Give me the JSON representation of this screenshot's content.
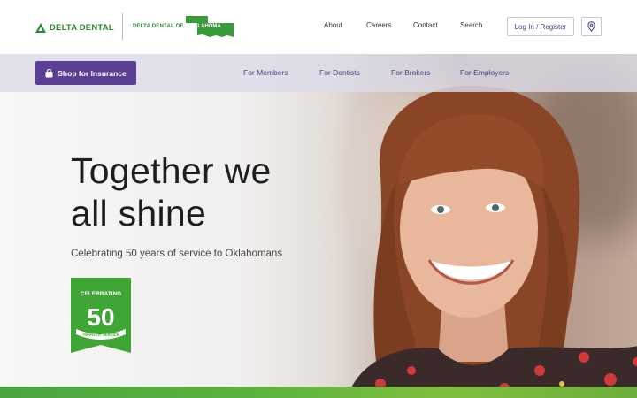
{
  "header": {
    "logo_text": "DELTA DENTAL",
    "sub_logo_prefix": "DELTA DENTAL OF",
    "sub_logo_state": "OKLAHOMA",
    "nav": [
      "About",
      "Careers",
      "Contact",
      "Search"
    ],
    "login_label": "Log In / Register",
    "location_icon": "location-pin-icon"
  },
  "subnav": {
    "shop_label": "Shop for Insurance",
    "links": [
      "For Members",
      "For Dentists",
      "For Brokers",
      "For Employers"
    ]
  },
  "hero": {
    "title_line1": "Together we",
    "title_line2": "all shine",
    "subtitle": "Celebrating 50 years of service to Oklahomans",
    "badge_top": "CELEBRATING",
    "badge_number": "50",
    "badge_ribbon": "YEARS OF SERVICE"
  },
  "colors": {
    "brand_green": "#2a8a2e",
    "brand_purple": "#5b3f94",
    "strip_green": "#5ab33e"
  }
}
